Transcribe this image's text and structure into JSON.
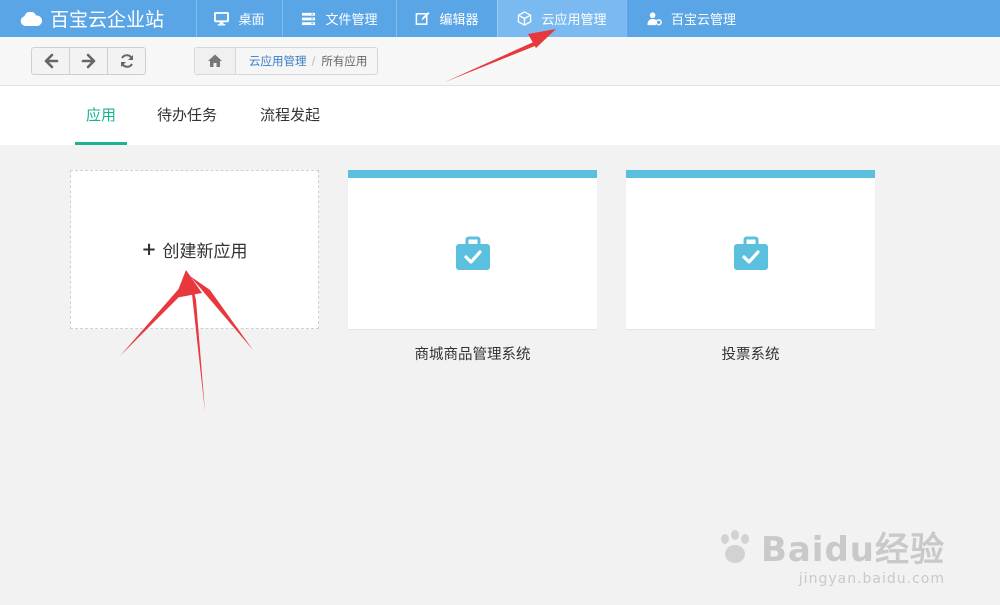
{
  "app": {
    "brand": "百宝云企业站"
  },
  "nav": {
    "items": [
      {
        "label": "桌面",
        "icon": "monitor-icon"
      },
      {
        "label": "文件管理",
        "icon": "server-icon"
      },
      {
        "label": "编辑器",
        "icon": "edit-icon"
      },
      {
        "label": "云应用管理",
        "icon": "cube-icon",
        "active": true
      },
      {
        "label": "百宝云管理",
        "icon": "user-gear-icon"
      }
    ]
  },
  "breadcrumb": {
    "link": "云应用管理",
    "separator": "/",
    "current": "所有应用"
  },
  "tabs": [
    {
      "label": "应用",
      "active": true
    },
    {
      "label": "待办任务"
    },
    {
      "label": "流程发起"
    }
  ],
  "create_card": {
    "plus": "+",
    "label": "创建新应用"
  },
  "apps": [
    {
      "name": "商城商品管理系统",
      "icon": "briefcase-check-icon"
    },
    {
      "name": "投票系统",
      "icon": "briefcase-check-icon"
    }
  ],
  "watermark": {
    "brand": "Baidu经验",
    "url": "jingyan.baidu.com"
  },
  "colors": {
    "nav_bg": "#5aa5e6",
    "nav_active": "#7bbaf0",
    "tab_active": "#1ab394",
    "card_accent": "#5bc0de",
    "annotation": "#e8383d"
  }
}
